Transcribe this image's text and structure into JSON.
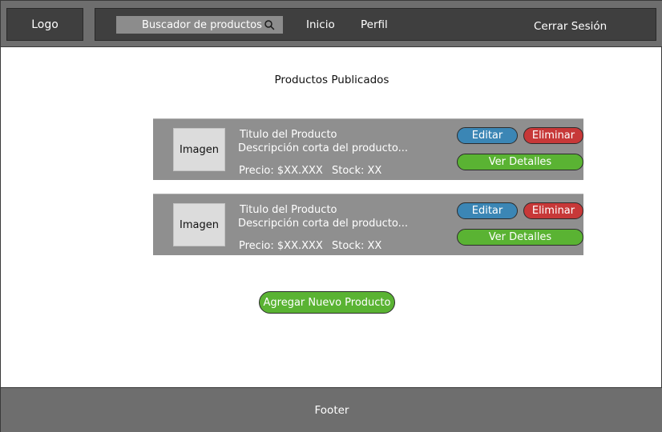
{
  "header": {
    "logo": "Logo",
    "search": {
      "placeholder": "Buscador de productos",
      "icon": "search-icon"
    },
    "nav": {
      "inicio": "Inicio",
      "perfil": "Perfil",
      "logout": "Cerrar Sesión"
    }
  },
  "main": {
    "title": "Productos Publicados",
    "products": [
      {
        "image_label": "Imagen",
        "title": "Titulo del Producto",
        "description": "Descripción corta del producto...",
        "price": "Precio: $XX.XXX",
        "stock": "Stock: XX",
        "edit": "Editar",
        "delete": "Eliminar",
        "details": "Ver Detalles"
      },
      {
        "image_label": "Imagen",
        "title": "Titulo del Producto",
        "description": "Descripción corta del producto...",
        "price": "Precio: $XX.XXX",
        "stock": "Stock: XX",
        "edit": "Editar",
        "delete": "Eliminar",
        "details": "Ver Detalles"
      }
    ],
    "add_button": "Agregar Nuevo Producto"
  },
  "footer": {
    "label": "Footer"
  },
  "colors": {
    "edit": "#3b86b5",
    "delete": "#c73838",
    "details": "#5ab333",
    "header_bg": "#6e6e6e",
    "nav_bg": "#3f3f3f",
    "card_bg": "#8f8f8f"
  }
}
